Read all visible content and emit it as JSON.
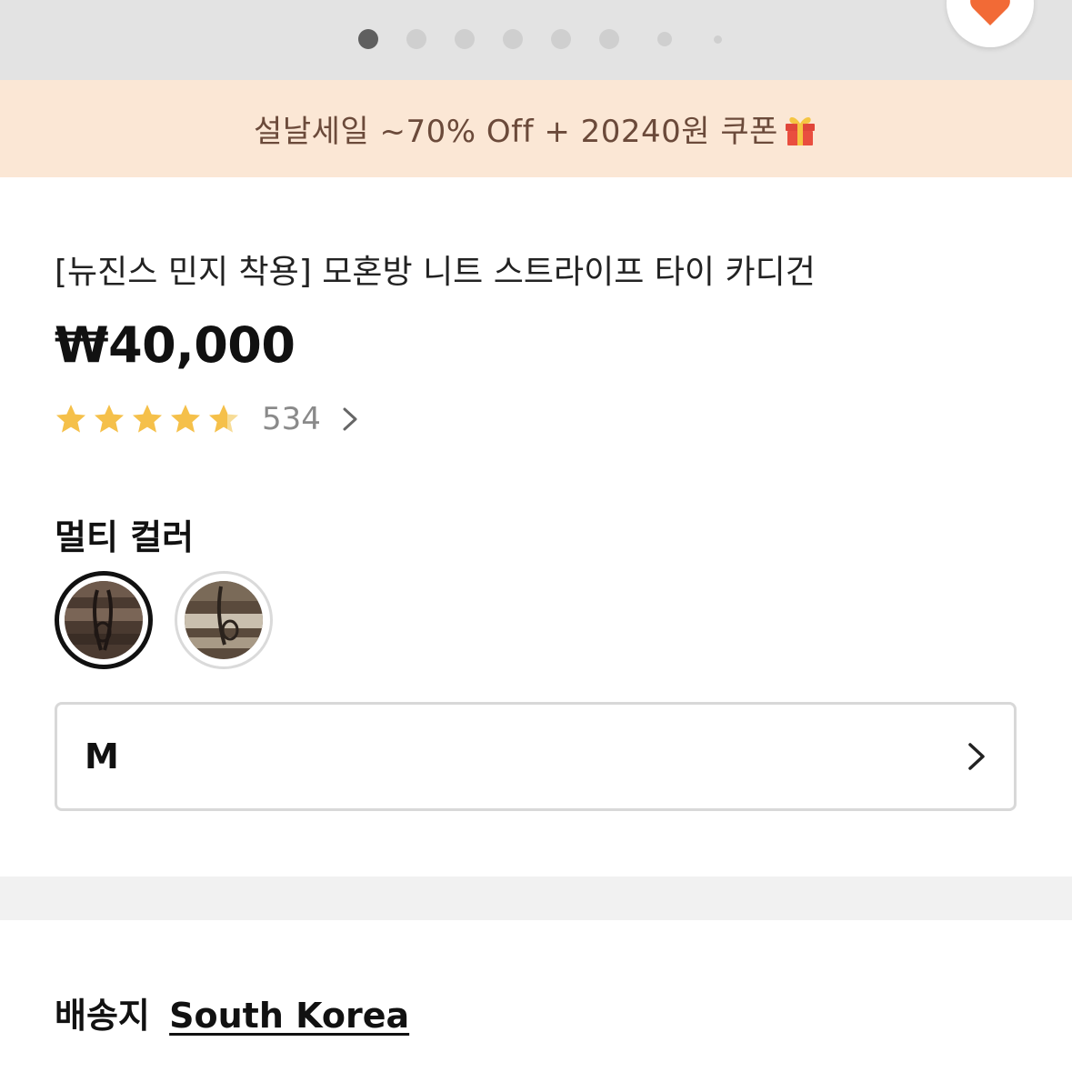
{
  "carousel": {
    "dot_count": 8,
    "active_index": 0
  },
  "wishlist": {
    "icon": "heart-icon",
    "color": "#f26a36"
  },
  "promo": {
    "text": "설날세일 ~70% Off + 20240원 쿠폰",
    "icon": "gift-icon",
    "background": "#fbe7d5",
    "text_color": "#6b4a3a"
  },
  "product": {
    "title": "[뉴진스 민지 착용] 모혼방 니트 스트라이프 타이 카디건",
    "price": "₩40,000"
  },
  "rating": {
    "stars": 4.5,
    "max_stars": 5,
    "star_color": "#f5c04a",
    "review_count": "534"
  },
  "color_option": {
    "label": "멀티 컬러",
    "swatches": [
      {
        "name": "swatch-dark-brown",
        "selected": true
      },
      {
        "name": "swatch-brown-stripe",
        "selected": false
      }
    ]
  },
  "size_option": {
    "value": "M"
  },
  "shipping": {
    "label": "배송지",
    "country": "South Korea"
  }
}
